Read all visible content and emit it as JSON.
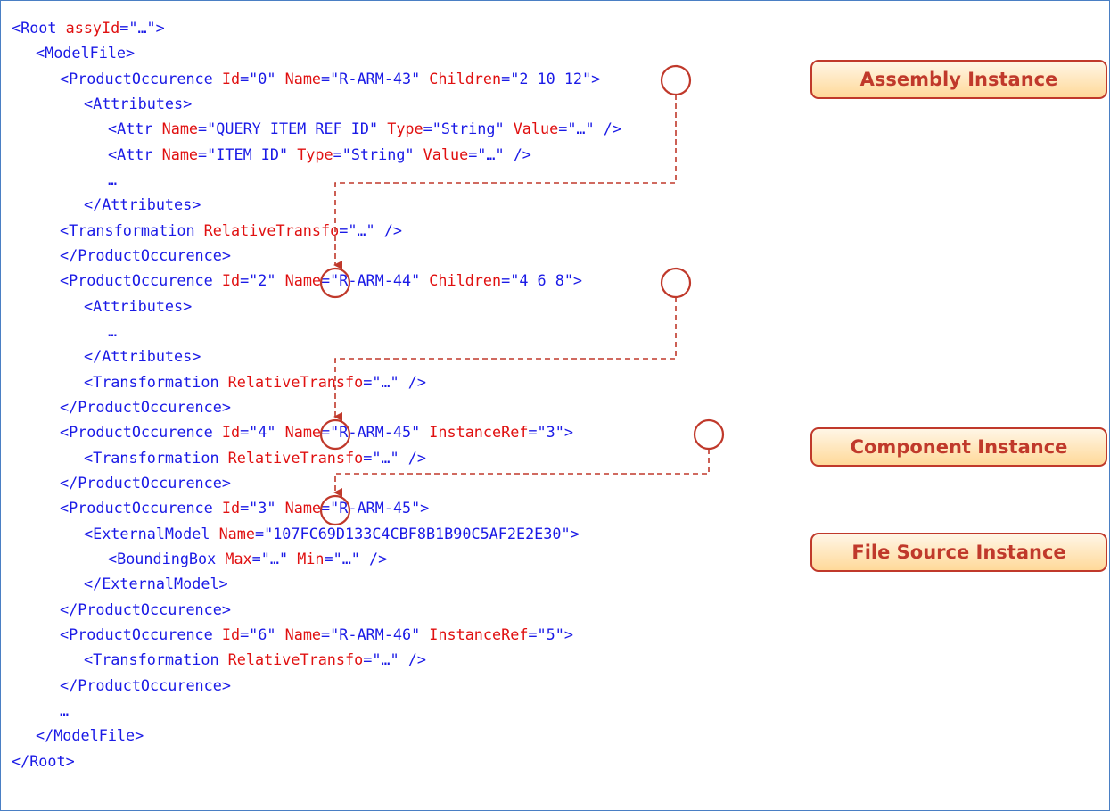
{
  "xml_lines": [
    {
      "indent": 1,
      "tokens": [
        {
          "t": "<Root ",
          "c": "b"
        },
        {
          "t": "assyId",
          "c": "r"
        },
        {
          "t": "=\"…\">",
          "c": "b"
        }
      ]
    },
    {
      "indent": 2,
      "tokens": [
        {
          "t": "<ModelFile>",
          "c": "b"
        }
      ]
    },
    {
      "indent": 3,
      "tokens": [
        {
          "t": "<ProductOccurence ",
          "c": "b"
        },
        {
          "t": "Id",
          "c": "r"
        },
        {
          "t": "=\"0\" ",
          "c": "b"
        },
        {
          "t": "Name",
          "c": "r"
        },
        {
          "t": "=\"R-ARM-43\" ",
          "c": "b"
        },
        {
          "t": "Children",
          "c": "r"
        },
        {
          "t": "=\"2 10 12\">",
          "c": "b"
        }
      ]
    },
    {
      "indent": 4,
      "tokens": [
        {
          "t": "<Attributes>",
          "c": "b"
        }
      ]
    },
    {
      "indent": 5,
      "tokens": [
        {
          "t": "<Attr ",
          "c": "b"
        },
        {
          "t": "Name",
          "c": "r"
        },
        {
          "t": "=\"QUERY ITEM REF ID\" ",
          "c": "b"
        },
        {
          "t": "Type",
          "c": "r"
        },
        {
          "t": "=\"String\" ",
          "c": "b"
        },
        {
          "t": "Value",
          "c": "r"
        },
        {
          "t": "=\"…\" />",
          "c": "b"
        }
      ]
    },
    {
      "indent": 5,
      "tokens": [
        {
          "t": "<Attr ",
          "c": "b"
        },
        {
          "t": "Name",
          "c": "r"
        },
        {
          "t": "=\"ITEM ID\" ",
          "c": "b"
        },
        {
          "t": "Type",
          "c": "r"
        },
        {
          "t": "=\"String\" ",
          "c": "b"
        },
        {
          "t": "Value",
          "c": "r"
        },
        {
          "t": "=\"…\" />",
          "c": "b"
        }
      ]
    },
    {
      "indent": 5,
      "tokens": [
        {
          "t": "…",
          "c": "b"
        }
      ]
    },
    {
      "indent": 4,
      "tokens": [
        {
          "t": "</Attributes>",
          "c": "b"
        }
      ]
    },
    {
      "indent": 3,
      "tokens": [
        {
          "t": "<Transformation ",
          "c": "b"
        },
        {
          "t": "RelativeTransfo",
          "c": "r"
        },
        {
          "t": "=\"…\" />",
          "c": "b"
        }
      ]
    },
    {
      "indent": 3,
      "tokens": [
        {
          "t": "</ProductOccurence>",
          "c": "b"
        }
      ]
    },
    {
      "indent": 3,
      "tokens": [
        {
          "t": "<ProductOccurence ",
          "c": "b"
        },
        {
          "t": "Id",
          "c": "r"
        },
        {
          "t": "=\"2\" ",
          "c": "b"
        },
        {
          "t": "Name",
          "c": "r"
        },
        {
          "t": "=\"R-ARM-44\" ",
          "c": "b"
        },
        {
          "t": "Children",
          "c": "r"
        },
        {
          "t": "=\"4 6 8\">",
          "c": "b"
        }
      ]
    },
    {
      "indent": 4,
      "tokens": [
        {
          "t": "<Attributes>",
          "c": "b"
        }
      ]
    },
    {
      "indent": 5,
      "tokens": [
        {
          "t": "…",
          "c": "b"
        }
      ]
    },
    {
      "indent": 4,
      "tokens": [
        {
          "t": "</Attributes>",
          "c": "b"
        }
      ]
    },
    {
      "indent": 4,
      "tokens": [
        {
          "t": "<Transformation ",
          "c": "b"
        },
        {
          "t": "RelativeTransfo",
          "c": "r"
        },
        {
          "t": "=\"…\" />",
          "c": "b"
        }
      ]
    },
    {
      "indent": 3,
      "tokens": [
        {
          "t": "</ProductOccurence>",
          "c": "b"
        }
      ]
    },
    {
      "indent": 3,
      "tokens": [
        {
          "t": "<ProductOccurence ",
          "c": "b"
        },
        {
          "t": "Id",
          "c": "r"
        },
        {
          "t": "=\"4\" ",
          "c": "b"
        },
        {
          "t": "Name",
          "c": "r"
        },
        {
          "t": "=\"R-ARM-45\" ",
          "c": "b"
        },
        {
          "t": "InstanceRef",
          "c": "r"
        },
        {
          "t": "=\"3\">",
          "c": "b"
        }
      ]
    },
    {
      "indent": 4,
      "tokens": [
        {
          "t": "<Transformation ",
          "c": "b"
        },
        {
          "t": "RelativeTransfo",
          "c": "r"
        },
        {
          "t": "=\"…\" />",
          "c": "b"
        }
      ]
    },
    {
      "indent": 3,
      "tokens": [
        {
          "t": "</ProductOccurence>",
          "c": "b"
        }
      ]
    },
    {
      "indent": 3,
      "tokens": [
        {
          "t": "<ProductOccurence ",
          "c": "b"
        },
        {
          "t": "Id",
          "c": "r"
        },
        {
          "t": "=\"3\" ",
          "c": "b"
        },
        {
          "t": "Name",
          "c": "r"
        },
        {
          "t": "=\"R-ARM-45\">",
          "c": "b"
        }
      ]
    },
    {
      "indent": 4,
      "tokens": [
        {
          "t": "<ExternalModel ",
          "c": "b"
        },
        {
          "t": "Name",
          "c": "r"
        },
        {
          "t": "=\"107FC69D133C4CBF8B1B90C5AF2E2E30\">",
          "c": "b"
        }
      ]
    },
    {
      "indent": 5,
      "tokens": [
        {
          "t": "<BoundingBox ",
          "c": "b"
        },
        {
          "t": "Max",
          "c": "r"
        },
        {
          "t": "=\"…\" ",
          "c": "b"
        },
        {
          "t": "Min",
          "c": "r"
        },
        {
          "t": "=\"…\" />",
          "c": "b"
        }
      ]
    },
    {
      "indent": 4,
      "tokens": [
        {
          "t": "</ExternalModel>",
          "c": "b"
        }
      ]
    },
    {
      "indent": 3,
      "tokens": [
        {
          "t": "</ProductOccurence>",
          "c": "b"
        }
      ]
    },
    {
      "indent": 3,
      "tokens": [
        {
          "t": "<ProductOccurence ",
          "c": "b"
        },
        {
          "t": "Id",
          "c": "r"
        },
        {
          "t": "=\"6\" ",
          "c": "b"
        },
        {
          "t": "Name",
          "c": "r"
        },
        {
          "t": "=\"R-ARM-46\" ",
          "c": "b"
        },
        {
          "t": "InstanceRef",
          "c": "r"
        },
        {
          "t": "=\"5\">",
          "c": "b"
        }
      ]
    },
    {
      "indent": 4,
      "tokens": [
        {
          "t": "<Transformation ",
          "c": "b"
        },
        {
          "t": "RelativeTransfo",
          "c": "r"
        },
        {
          "t": "=\"…\" />",
          "c": "b"
        }
      ]
    },
    {
      "indent": 3,
      "tokens": [
        {
          "t": "</ProductOccurence>",
          "c": "b"
        }
      ]
    },
    {
      "indent": 3,
      "tokens": [
        {
          "t": "…",
          "c": "b"
        }
      ]
    },
    {
      "indent": 2,
      "tokens": [
        {
          "t": "</ModelFile>",
          "c": "b"
        }
      ]
    },
    {
      "indent": 1,
      "tokens": [
        {
          "t": "</Root>",
          "c": "b"
        }
      ]
    }
  ],
  "labels": {
    "assembly": "Assembly Instance",
    "component": "Component Instance",
    "file_source": "File Source Instance"
  },
  "colors": {
    "tag": "#1a1ae6",
    "attribute": "#e01010",
    "annotation": "#c0392b",
    "frame_border": "#4a7fc4"
  }
}
